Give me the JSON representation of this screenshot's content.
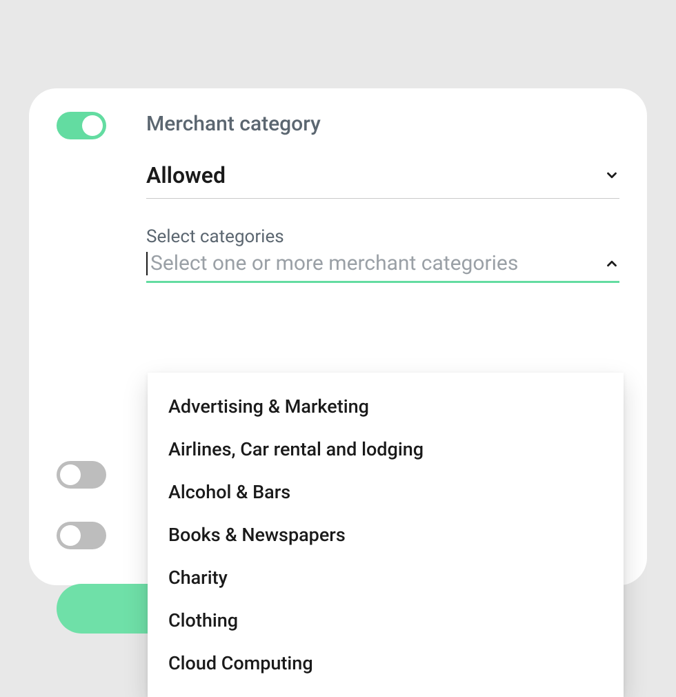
{
  "colors": {
    "accent": "#63dca1",
    "toggle_off": "#bdbdbd",
    "text_muted": "#5b6670",
    "text": "#1a1a1a",
    "placeholder": "#9aa0a6",
    "page_bg": "#e8e8e8",
    "card_bg": "#ffffff"
  },
  "merchant_category": {
    "toggle_on": true,
    "title": "Merchant category",
    "mode_select": {
      "value": "Allowed"
    },
    "categories_field": {
      "label": "Select categories",
      "placeholder": "Select one or more merchant categories"
    },
    "dropdown_options": [
      "Advertising & Marketing",
      "Airlines, Car rental and lodging",
      "Alcohol & Bars",
      "Books & Newspapers",
      "Charity",
      "Clothing",
      "Cloud Computing"
    ]
  },
  "secondary_toggles": [
    {
      "on": false
    },
    {
      "on": false
    }
  ],
  "primary_button": {
    "label": ""
  }
}
